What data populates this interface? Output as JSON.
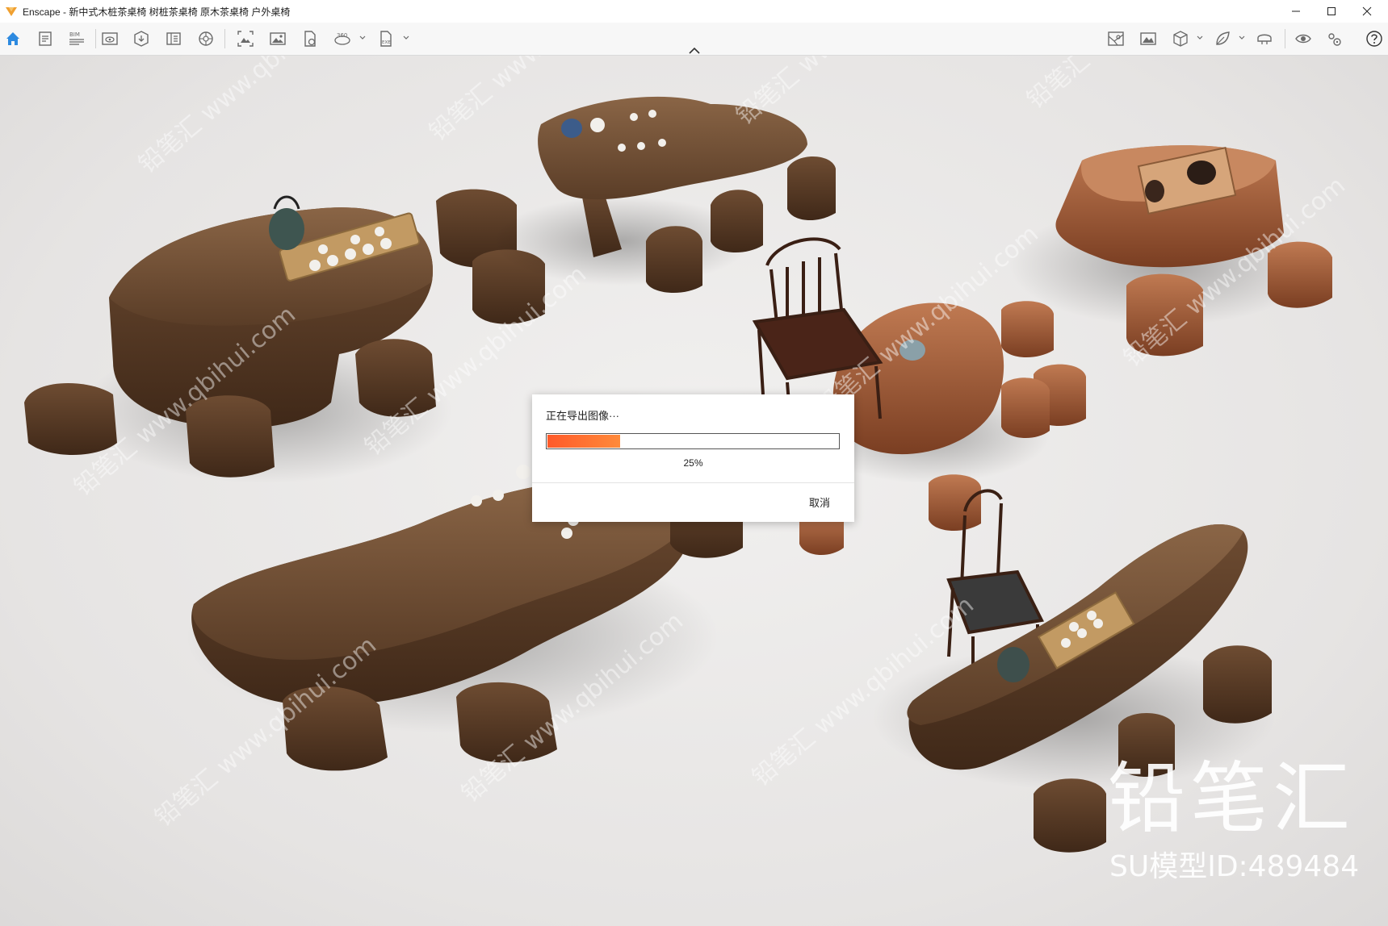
{
  "window": {
    "title": "Enscape - 新中式木桩茶桌椅 树桩茶桌椅 原木茶桌椅 户外桌椅",
    "accent_color": "#f0a030"
  },
  "toolbar": {
    "active_color": "#2d8ae0",
    "icon_color": "#6a6a6a",
    "bim_label": "BIM",
    "pano_label": "360",
    "exe_label": "EXE"
  },
  "dialog": {
    "title": "正在导出图像···",
    "progress_percent": 25,
    "progress_label": "25%",
    "cancel_label": "取消"
  },
  "watermark": {
    "brand": "铅笔汇",
    "model_id": "SU模型ID:489484",
    "pattern_text": "铅笔汇 www.qbihui.com"
  }
}
